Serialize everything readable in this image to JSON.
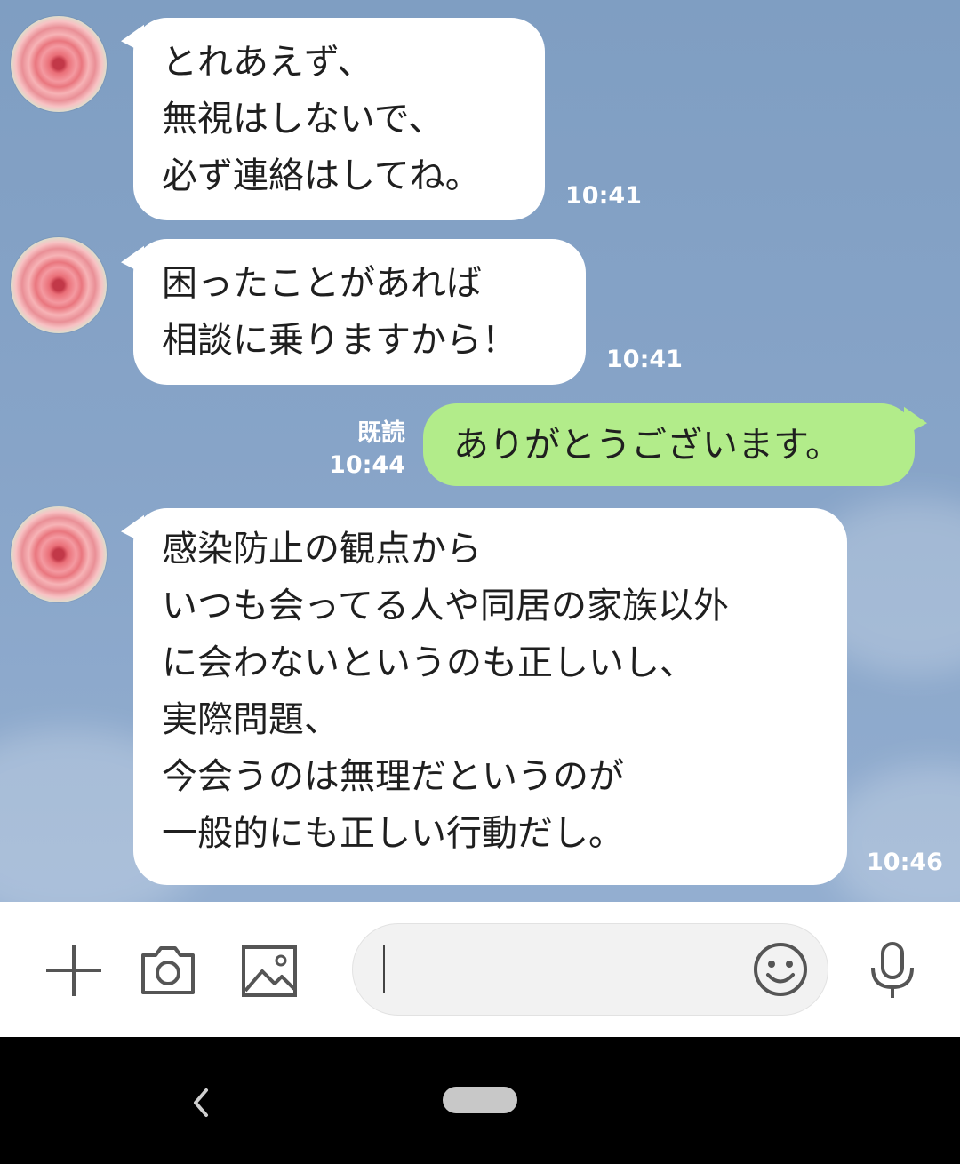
{
  "messages": [
    {
      "from": "other",
      "lines": [
        "とれあえず、",
        "無視はしないで、",
        "必ず連絡はしてね。"
      ],
      "time": "10:41"
    },
    {
      "from": "other",
      "lines": [
        "困ったことがあれば",
        "相談に乗りますから！"
      ],
      "time": "10:41"
    },
    {
      "from": "me",
      "lines": [
        "ありがとうございます。"
      ],
      "time": "10:44",
      "status": "既読"
    },
    {
      "from": "other",
      "lines": [
        "感染防止の観点から",
        "いつも会ってる人や同居の家族以外",
        "に会わないというのも正しいし、",
        "実際問題、",
        "今会うのは無理だというのが",
        "一般的にも正しい行動だし。"
      ],
      "time": "10:46"
    }
  ],
  "input_bar": {
    "text_value": "",
    "icons": [
      "plus-icon",
      "camera-icon",
      "image-icon",
      "emoji-icon",
      "microphone-icon"
    ]
  },
  "colors": {
    "chat_background": "#87a4c8",
    "incoming_bubble": "#ffffff",
    "outgoing_bubble": "#b2ec8a",
    "meta_text": "#ffffff"
  },
  "nav_bar": {
    "icons": [
      "back-icon",
      "home-pill-icon"
    ]
  }
}
